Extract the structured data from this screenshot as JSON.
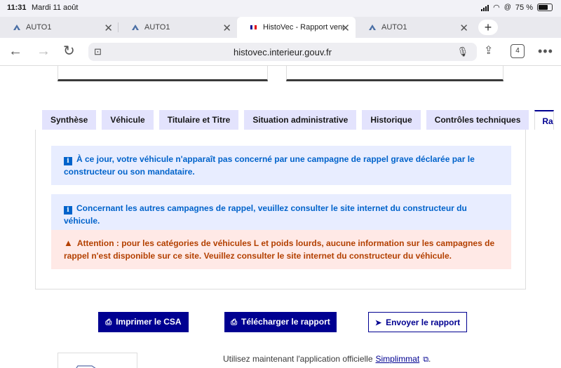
{
  "status": {
    "time": "11:31",
    "date": "Mardi 11 août",
    "battery": "75 %"
  },
  "tabs": [
    {
      "label": "AUTO1"
    },
    {
      "label": "AUTO1"
    },
    {
      "label": "HistoVec - Rapport vend"
    },
    {
      "label": "AUTO1"
    }
  ],
  "toolbar": {
    "url": "histovec.interieur.gouv.fr",
    "tab_count": "4"
  },
  "page": {
    "tabs": [
      "Synthèse",
      "Véhicule",
      "Titulaire et Titre",
      "Situation administrative",
      "Historique",
      "Contrôles techniques",
      "Rappels"
    ],
    "alerts": {
      "info1": "À ce jour, votre véhicule n'apparaît pas concerné par une campagne de rappel grave déclarée par le constructeur ou son mandataire.",
      "info2": "Concernant les autres campagnes de rappel, veuillez consulter le site internet du constructeur du véhicule.",
      "warn": "Attention : pour les catégories de véhicules L et poids lourds, aucune information sur les campagnes de rappel n'est disponible sur ce site. Veuillez consulter le site internet du constructeur du véhicule."
    },
    "buttons": {
      "print": "Imprimer le CSA",
      "download": "Télécharger le rapport",
      "send": "Envoyer le rapport"
    },
    "footer": {
      "text": "Utilisez maintenant l'application officielle",
      "link": "Simplimmat",
      "end": "."
    }
  }
}
